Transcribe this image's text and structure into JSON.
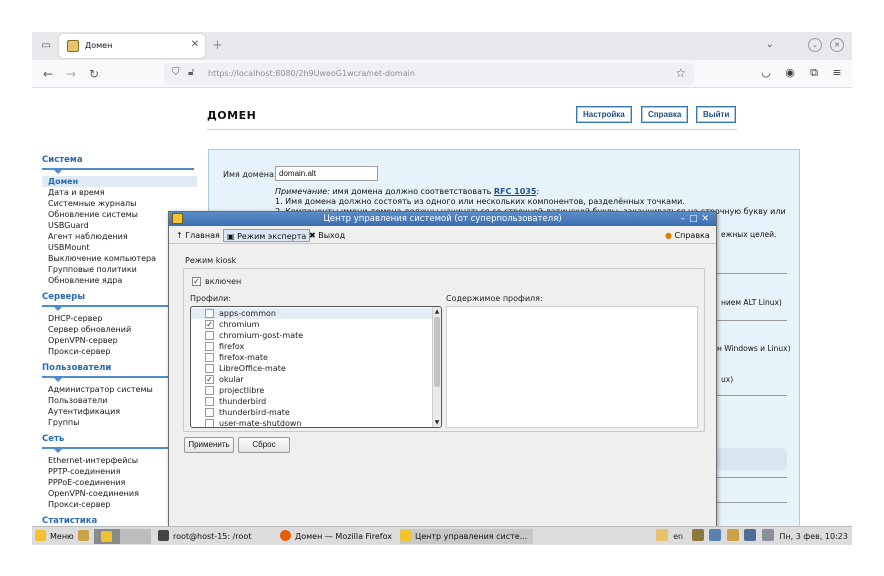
{
  "browser": {
    "tab_title": "Домен",
    "url_host": "https://localhost",
    "url_rest": ":8080/2h9UweoG1wcra/net-domain"
  },
  "page": {
    "title": "ДОМЕН",
    "buttons": {
      "settings": "Настройка",
      "help": "Справка",
      "logout": "Выйти"
    }
  },
  "sidebar": {
    "sections": [
      {
        "title": "Система",
        "items": [
          "Домен",
          "Дата и время",
          "Системные журналы",
          "Обновление системы",
          "USBGuard",
          "Агент наблюдения",
          "USBMount",
          "Выключение компьютера",
          "Групповые политики",
          "Обновление ядра"
        ]
      },
      {
        "title": "Серверы",
        "items": [
          "DHCP-сервер",
          "Сервер обновлений",
          "OpenVPN-сервер",
          "Прокси-сервер"
        ]
      },
      {
        "title": "Пользователи",
        "items": [
          "Администратор системы",
          "Пользователи",
          "Аутентификация",
          "Группы"
        ]
      },
      {
        "title": "Сеть",
        "items": [
          "Ethernet-интерфейсы",
          "PPTP-соединения",
          "PPPoE-соединения",
          "OpenVPN-соединения",
          "Прокси-сервер"
        ]
      },
      {
        "title": "Статистика",
        "items": []
      }
    ],
    "active": "Домен"
  },
  "content": {
    "domain_label": "Имя домена:",
    "domain_value": "domain.alt",
    "note_prefix": "Примечание:",
    "note_text": " имя домена должно соответствовать ",
    "note_link": "RFC 1035",
    "note_suffix": ":",
    "rule1": "1. Имя домена должно состоять из одного или нескольких компонентов, разделённых точками.",
    "rule2": "2. Компоненты имени домена должны начинаться со строчной латинской буквы, заканчиваться на строчную букву или",
    "peek_1": "ежных целей.",
    "peek_2": "нием ALT Linux)",
    "peek_3": "н Windows и Linux)",
    "peek_4": "ux)"
  },
  "dialog": {
    "title": "Центр управления системой (от суперпользователя)",
    "toolbar": {
      "home": "Главная",
      "expert": "Режим эксперта",
      "exit": "Выход",
      "help": "Справка"
    },
    "kiosk_title": "Режим kiosk",
    "enabled_label": "включен",
    "enabled_checked": true,
    "profiles_label": "Профили:",
    "profile_content_label": "Содержимое профиля:",
    "profiles": [
      {
        "name": "apps-common",
        "checked": false
      },
      {
        "name": "chromium",
        "checked": true
      },
      {
        "name": "chromium-gost-mate",
        "checked": false
      },
      {
        "name": "firefox",
        "checked": false
      },
      {
        "name": "firefox-mate",
        "checked": false
      },
      {
        "name": "LibreOffice-mate",
        "checked": false
      },
      {
        "name": "okular",
        "checked": true
      },
      {
        "name": "projectlibre",
        "checked": false
      },
      {
        "name": "thunderbird",
        "checked": false
      },
      {
        "name": "thunderbird-mate",
        "checked": false
      },
      {
        "name": "user-mate-shutdown",
        "checked": false
      }
    ],
    "apply_label": "Применить",
    "reset_label": "Сброс"
  },
  "taskbar": {
    "menu_label": "Меню",
    "items": [
      "root@host-15: /root",
      "Домен — Mozilla Firefox",
      "Центр управления систе..."
    ],
    "lang": "en",
    "clock": "Пн, 3 фев, 10:23"
  }
}
